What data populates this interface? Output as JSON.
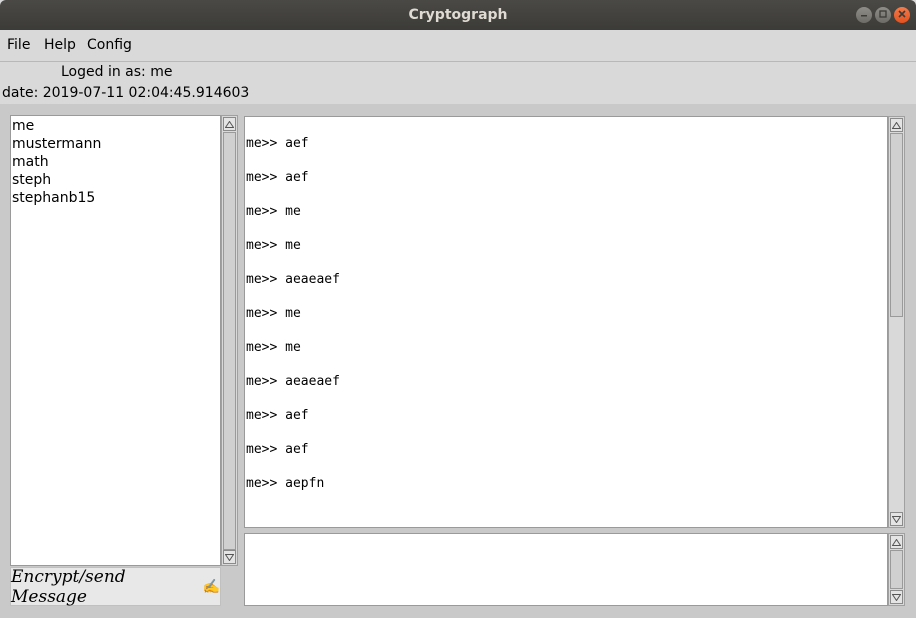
{
  "window": {
    "title": "Cryptograph"
  },
  "menu": [
    {
      "label": "File"
    },
    {
      "label": "Help"
    },
    {
      "label": "Config"
    }
  ],
  "status": {
    "login": "Loged in as: me",
    "date": "date: 2019-07-11 02:04:45.914603"
  },
  "users": [
    {
      "name": "me"
    },
    {
      "name": "mustermann"
    },
    {
      "name": "math"
    },
    {
      "name": "steph"
    },
    {
      "name": "stephanb15"
    }
  ],
  "send_button": {
    "label": "Encrypt/send Message",
    "icon": "✍"
  },
  "messages": [
    {
      "text": "me>> aef"
    },
    {
      "text": "me>> aef"
    },
    {
      "text": "me>> me"
    },
    {
      "text": "me>> me"
    },
    {
      "text": "me>> aeaeaef"
    },
    {
      "text": "me>> me"
    },
    {
      "text": "me>> me"
    },
    {
      "text": "me>> aeaeaef"
    },
    {
      "text": "me>> aef"
    },
    {
      "text": "me>> aef"
    },
    {
      "text": "me>> aepfn"
    }
  ],
  "message_input": {
    "value": ""
  },
  "icons": {
    "minimize": "minimize-icon",
    "maximize": "maximize-icon",
    "close": "close-icon",
    "pen": "pen-icon"
  },
  "colors": {
    "titlebar": "#3c3b37",
    "close_button": "#e3521e",
    "background": "#d9d9d9"
  }
}
